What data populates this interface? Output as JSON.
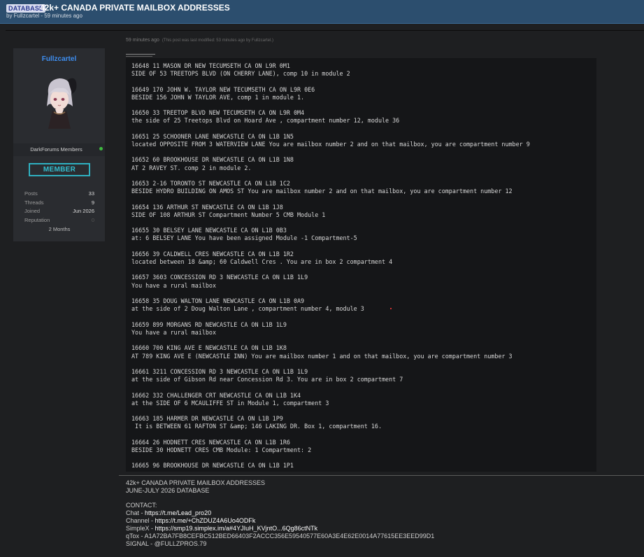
{
  "header": {
    "badge": "DATABASE",
    "title": "42k+ CANADA PRIVATE MAILBOX ADDRESSES",
    "byline": "by Fullzcartel - 59 minutes ago"
  },
  "post": {
    "time": "59 minutes ago",
    "modified": "(This post was last modified: 53 minutes ago by Fullzcartel.)"
  },
  "author": {
    "username": "Fullzcartel",
    "group": "DarkForums Members",
    "rank": "MEMBER",
    "stats": [
      {
        "label": "Posts",
        "value": "33"
      },
      {
        "label": "Threads",
        "value": "9"
      },
      {
        "label": "Joined",
        "value": "Jun 2026"
      },
      {
        "label": "Reputation",
        "value": "0"
      }
    ],
    "membership": "2 Months"
  },
  "records": [
    "16648 11 MASON DR NEW TECUMSETH CA ON L9R 0M1",
    "SIDE OF 53 TREETOPS BLVD (ON CHERRY LANE), comp 10 in module 2",
    "",
    "16649 170 JOHN W. TAYLOR NEW TECUMSETH CA ON L9R 0E6",
    "BESIDE 156 JOHN W TAYLOR AVE, comp 1 in module 1.",
    "",
    "16650 33 TREETOP BLVD NEW TECUMSETH CA ON L9R 0M4",
    "the side of 25 Treetops Blvd on Hoard Ave , compartment number 12, module 36",
    "",
    "16651 25 SCHOONER LANE NEWCASTLE CA ON L1B 1N5",
    "located OPPOSITE FROM 3 WATERVIEW LANE You are mailbox number 2 and on that mailbox, you are compartment number 9",
    "",
    "16652 60 BROOKHOUSE DR NEWCASTLE CA ON L1B 1N8",
    "AT 2 RAVEY ST. comp 2 in module 2.",
    "",
    "16653 2-16 TORONTO ST NEWCASTLE CA ON L1B 1C2",
    "BESIDE HYDRO BUILDING ON AMOS ST You are mailbox number 2 and on that mailbox, you are compartment number 12",
    "",
    "16654 136 ARTHUR ST NEWCASTLE CA ON L1B 1J8",
    "SIDE OF 108 ARTHUR ST Compartment Number 5 CMB Module 1",
    "",
    "16655 30 BELSEY LANE NEWCASTLE CA ON L1B 0B3",
    "at: 6 BELSEY LANE You have been assigned Module -1 Compartment-5",
    "",
    "16656 39 CALDWELL CRES NEWCASTLE CA ON L1B 1R2",
    "located between 18 &amp; 60 Caldwell Cres . You are in box 2 compartment 4",
    "",
    "16657 3603 CONCESSION RD 3 NEWCASTLE CA ON L1B 1L9",
    "You have a rural mailbox",
    "",
    "16658 35 DOUG WALTON LANE NEWCASTLE CA ON L1B 0A9",
    "at the side of 2 Doug Walton Lane , compartment number 4, module 3",
    "",
    "16659 899 MORGANS RD NEWCASTLE CA ON L1B 1L9",
    "You have a rural mailbox",
    "",
    "16660 700 KING AVE E NEWCASTLE CA ON L1B 1K8",
    "AT 789 KING AVE E (NEWCASTLE INN) You are mailbox number 1 and on that mailbox, you are compartment number 3",
    "",
    "16661 3211 CONCESSION RD 3 NEWCASTLE CA ON L1B 1L9",
    "at the side of Gibson Rd near Concession Rd 3. You are in box 2 compartment 7",
    "",
    "16662 332 CHALLENGER CRT NEWCASTLE CA ON L1B 1K4",
    "at the SIDE OF 6 MCAULIFFE ST in Module 1, compartment 3",
    "",
    "16663 185 HARMER DR NEWCASTLE CA ON L1B 1P9",
    " It is BETWEEN 61 RAFTON ST &amp; 146 LAKING DR. Box 1, compartment 16.",
    "",
    "16664 26 HODNETT CRES NEWCASTLE CA ON L1B 1R6",
    "BESIDE 30 HODNETT CRES CMB Module: 1 Compartment: 2",
    "",
    "16665 96 BROOKHOUSE DR NEWCASTLE CA ON L1B 1P1"
  ],
  "footer": {
    "line1": "42k+ CANADA PRIVATE MAILBOX ADDRESSES",
    "line2": "JUNE-JULY 2026 DATABASE",
    "contact_heading": "CONTACT:",
    "contacts": [
      {
        "label": "Chat - ",
        "value": "https://t.me/Lead_pro20"
      },
      {
        "label": "Channel - ",
        "value": "https://t.me/+ChZDUZ4A6Uo4ODFk"
      },
      {
        "label": "SimpleX - ",
        "value": "https://smp19.simplex.im/a#4YJIuH_KVjntO...6Qg86ctNTk"
      },
      {
        "label": "qTox - ",
        "value": "A1A72BA7FB8CEFBC512BED66403F2ACCC356E59540577E60A3E4E62E0014A77615EE3EED99D1"
      },
      {
        "label": "SIGNAL - ",
        "value": "@FULLZPROS.79"
      }
    ]
  }
}
